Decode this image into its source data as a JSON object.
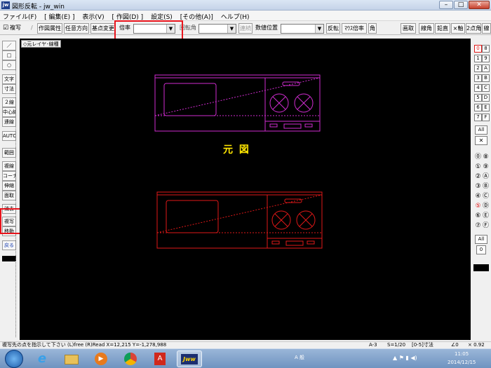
{
  "window": {
    "app_icon": "jw",
    "title": "図形反転 - jw_win",
    "minimize": "–",
    "maximize": "□",
    "close": "✕"
  },
  "menu": [
    "ファイル(F)",
    "[ 編集(E) ]",
    "表示(V)",
    "[ 作図(D) ]",
    "設定(S)",
    "[その他(A)]",
    "ヘルプ(H)"
  ],
  "toolbar": {
    "fukusha_check": "☑",
    "fukusha_label": "複写",
    "sakuzu_zokusei": "作図属性",
    "nini_houkou": "任意方向",
    "kiten_henkou": "基点変更",
    "bairitsu_label": "倍率",
    "bairitsu_value": "",
    "kaitenkaku_label": "回転角",
    "kaitenkaku_value": "",
    "renzoku": "連続",
    "suuchi_ichi_label": "数値位置",
    "suuchi_ichi_value": "",
    "hanten": "反転",
    "mouse_bairitsu": "ﾏｳｽ倍率",
    "kaku": "角",
    "right_buttons": [
      "画取",
      "線角",
      "鉛直",
      "×軸",
      "2点角",
      "線"
    ]
  },
  "left_tools": [
    {
      "label": "／",
      "group": 1
    },
    {
      "label": "□",
      "group": 1
    },
    {
      "label": "○",
      "group": 1
    },
    {
      "label": "文字",
      "group": 2
    },
    {
      "label": "寸法",
      "group": 2
    },
    {
      "label": "２線",
      "group": 3
    },
    {
      "label": "中心線",
      "group": 3
    },
    {
      "label": "連線",
      "group": 3
    },
    {
      "label": "AUTO",
      "group": 4
    },
    {
      "label": "範囲",
      "group": 5
    },
    {
      "label": "複線",
      "group": 5
    },
    {
      "label": "コーナー",
      "group": 5
    },
    {
      "label": "伸縮",
      "group": 5
    },
    {
      "label": "面取",
      "group": 5
    },
    {
      "label": "消去",
      "group": 5
    },
    {
      "label": "複写",
      "group": 5
    },
    {
      "label": "移動",
      "group": 5
    },
    {
      "label": "戻る",
      "group": 6
    }
  ],
  "layer_label": "◇元レイヤ･線種",
  "drawing": {
    "label_original": "元 図",
    "color_original": "#d02cd0",
    "color_copy": "#e01818",
    "color_label": "#ffe600"
  },
  "right_layers": {
    "layer_group_left": [
      "0",
      "1",
      "2",
      "3",
      "4",
      "5",
      "6",
      "7"
    ],
    "layer_group_right": [
      "8",
      "9",
      "A",
      "B",
      "C",
      "D",
      "E",
      "F"
    ],
    "all_label": "All",
    "x_label": "✕",
    "circled_left": [
      "⓪",
      "①",
      "②",
      "③",
      "④",
      "⑤",
      "⑥",
      "⑦"
    ],
    "circled_right": [
      "⑧",
      "⑨",
      "Ⓐ",
      "Ⓑ",
      "Ⓒ",
      "Ⓓ",
      "Ⓔ",
      "Ⓕ"
    ],
    "all_label2": "All",
    "zero_label": "0"
  },
  "status": {
    "message": "複写先の点を指示して下さい (L)free (R)Read  X=12,215  Y=-1,278,988",
    "paper": "A-3",
    "scale": "S=1/20",
    "dim": "[0-5]寸法",
    "angle": "∠0",
    "zoom": "× 0.92"
  },
  "taskbar": {
    "ime": "A 般",
    "time": "11:05",
    "date": "2014/12/15"
  }
}
